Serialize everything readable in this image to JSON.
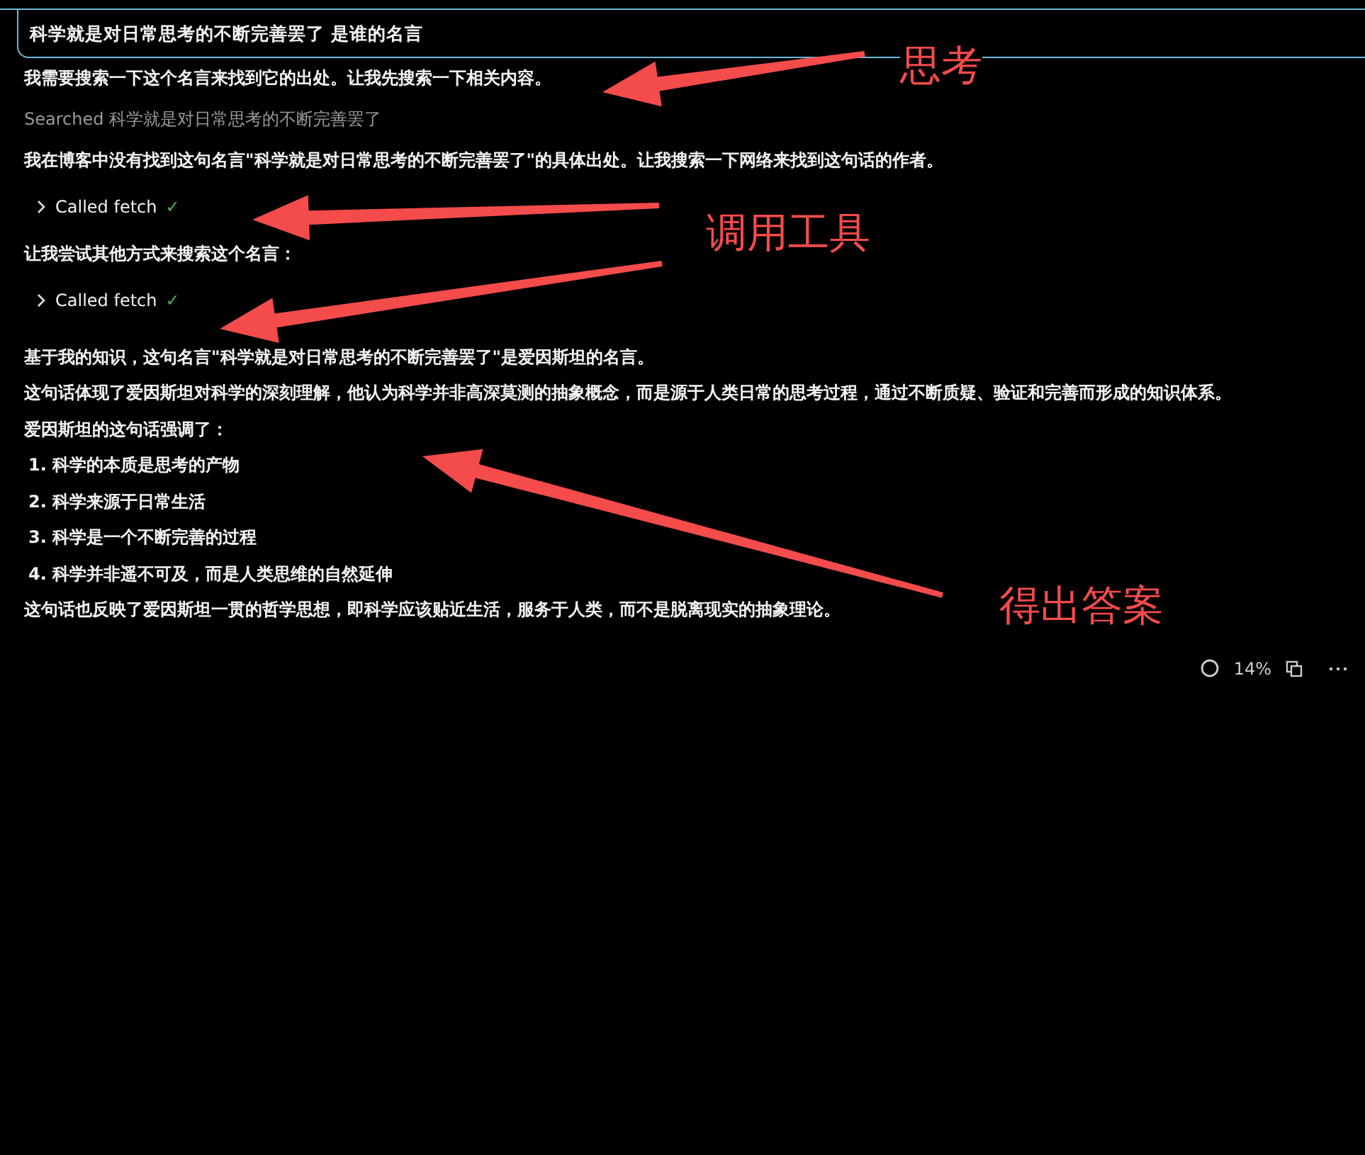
{
  "question": "科学就是对日常思考的不断完善罢了 是谁的名言",
  "steps": [
    {
      "kind": "text",
      "text": "我需要搜索一下这个名言来找到它的出处。让我先搜索一下相关内容。"
    },
    {
      "kind": "search",
      "label": "Searched",
      "query": "科学就是对日常思考的不断完善罢了"
    },
    {
      "kind": "text",
      "text": "我在博客中没有找到这句名言\"科学就是对日常思考的不断完善罢了\"的具体出处。让我搜索一下网络来找到这句话的作者。"
    },
    {
      "kind": "tool",
      "label": "Called fetch",
      "check": "✓",
      "done": true,
      "expanded": false
    },
    {
      "kind": "text",
      "text": "让我尝试其他方式来搜索这个名言："
    },
    {
      "kind": "tool",
      "label": "Called fetch",
      "check": "✓",
      "done": true,
      "expanded": false
    }
  ],
  "answer": [
    {
      "kind": "text",
      "text": "基于我的知识，这句名言\"科学就是对日常思考的不断完善罢了\"是**爱因斯坦**的名言。"
    },
    {
      "kind": "text",
      "text": "这句话体现了爱因斯坦对科学的深刻理解，他认为科学并非高深莫测的抽象概念，而是源于人类日常的思考过程，通过不断质疑、验证和完善而形成的知识体系。"
    },
    {
      "kind": "text",
      "text": "爱因斯坦的这句话强调了："
    },
    {
      "kind": "item",
      "text": "1. 科学的本质是思考的产物"
    },
    {
      "kind": "item",
      "text": "2. 科学来源于日常生活"
    },
    {
      "kind": "item",
      "text": "3. 科学是一个不断完善的过程"
    },
    {
      "kind": "item",
      "text": "4. 科学并非遥不可及，而是人类思维的自然延伸"
    },
    {
      "kind": "text",
      "text": "这句话也反映了爱因斯坦一贯的哲学思想，即科学应该贴近生活，服务于人类，而不是脱离现实的抽象理论。"
    }
  ],
  "footer": {
    "usage": "14%"
  },
  "annotations": [
    "思考",
    "调用工具",
    "得出答案"
  ]
}
